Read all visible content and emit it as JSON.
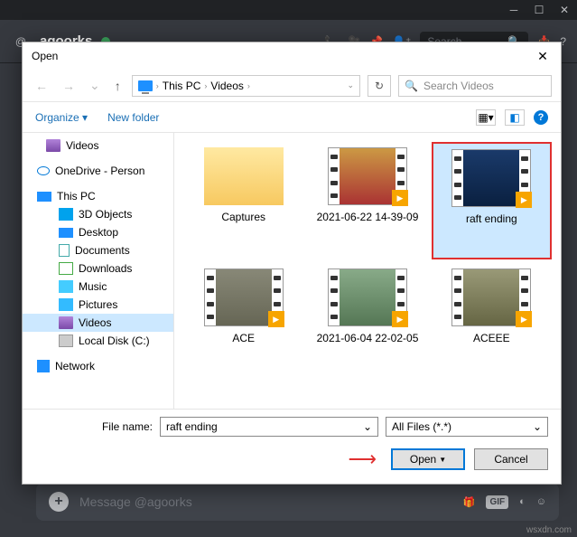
{
  "discord": {
    "username": "agoorks",
    "search_ph": "Search",
    "msg_ph": "Message @agoorks",
    "gif_label": "GIF"
  },
  "dialog": {
    "title": "Open",
    "crumb1": "This PC",
    "crumb2": "Videos",
    "search_ph": "Search Videos",
    "organize": "Organize",
    "newfolder": "New folder",
    "fn_label": "File name:",
    "fn_value": "raft ending",
    "filetype": "All Files (*.*)",
    "open_btn": "Open",
    "cancel_btn": "Cancel"
  },
  "tree": {
    "videos_top": "Videos",
    "onedrive": "OneDrive - Person",
    "thispc": "This PC",
    "objects3d": "3D Objects",
    "desktop": "Desktop",
    "documents": "Documents",
    "downloads": "Downloads",
    "music": "Music",
    "pictures": "Pictures",
    "videos": "Videos",
    "localdisk": "Local Disk (C:)",
    "network": "Network"
  },
  "files": {
    "f0": "Captures",
    "f1": "2021-06-22 14-39-09",
    "f2": "raft ending",
    "f3": "ACE",
    "f4": "2021-06-04 22-02-05",
    "f5": "ACEEE"
  },
  "watermark": "wsxdn.com"
}
